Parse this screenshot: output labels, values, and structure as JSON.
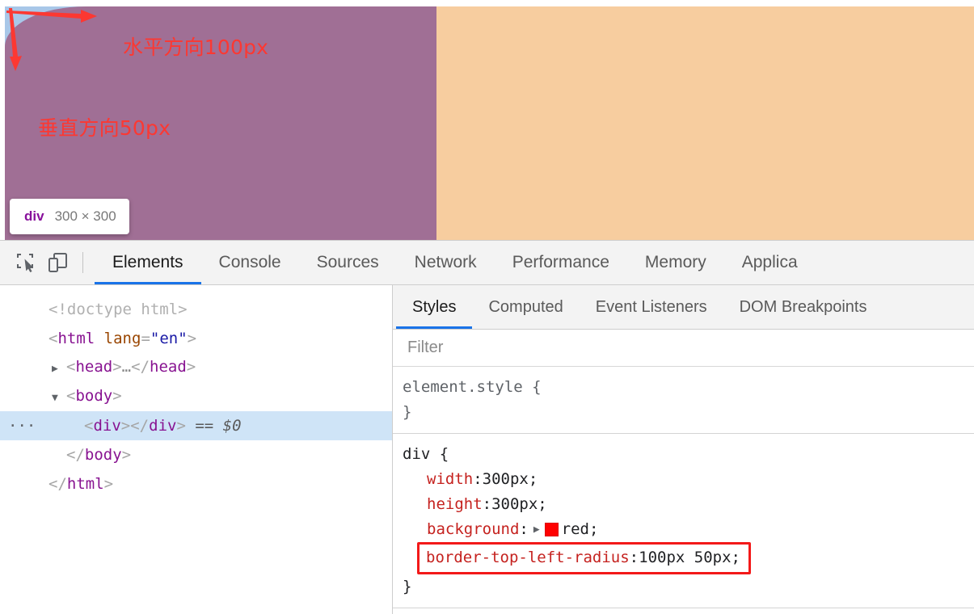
{
  "viewport": {
    "annotations": [
      {
        "id": "horizontal",
        "text": "水平方向100px"
      },
      {
        "id": "vertical",
        "text": "垂直方向50px"
      }
    ],
    "element_tooltip": {
      "tag": "div",
      "dimensions": "300 × 300"
    },
    "overlay_colors": {
      "content_box": "#a8c7e8",
      "margin_box": "#f7cd9f",
      "painted_element": "#a06f95",
      "annotation_red": "#fc3832"
    }
  },
  "devtools": {
    "toolbar": {
      "inspect_icon": "inspect-element-icon",
      "device_icon": "device-toolbar-icon"
    },
    "panel_tabs": [
      {
        "label": "Elements",
        "active": true
      },
      {
        "label": "Console",
        "active": false
      },
      {
        "label": "Sources",
        "active": false
      },
      {
        "label": "Network",
        "active": false
      },
      {
        "label": "Performance",
        "active": false
      },
      {
        "label": "Memory",
        "active": false
      },
      {
        "label": "Applica",
        "active": false
      }
    ],
    "dom_tree": [
      {
        "gutter": "",
        "indent": 0,
        "twisty": "",
        "selected": false,
        "parts": [
          {
            "t": "doctype",
            "v": "<!doctype html>"
          }
        ]
      },
      {
        "gutter": "",
        "indent": 0,
        "twisty": "",
        "selected": false,
        "parts": [
          {
            "t": "bracket",
            "v": "<"
          },
          {
            "t": "tag",
            "v": "html"
          },
          {
            "t": "space",
            "v": " "
          },
          {
            "t": "attr",
            "v": "lang"
          },
          {
            "t": "bracket",
            "v": "="
          },
          {
            "t": "val",
            "v": "\"en\""
          },
          {
            "t": "bracket",
            "v": ">"
          }
        ]
      },
      {
        "gutter": "",
        "indent": 1,
        "twisty": "▶",
        "selected": false,
        "parts": [
          {
            "t": "bracket",
            "v": "<"
          },
          {
            "t": "tag",
            "v": "head"
          },
          {
            "t": "bracket",
            "v": ">"
          },
          {
            "t": "ellip",
            "v": "…"
          },
          {
            "t": "bracket",
            "v": "</"
          },
          {
            "t": "tag",
            "v": "head"
          },
          {
            "t": "bracket",
            "v": ">"
          }
        ]
      },
      {
        "gutter": "",
        "indent": 1,
        "twisty": "▼",
        "selected": false,
        "parts": [
          {
            "t": "bracket",
            "v": "<"
          },
          {
            "t": "tag",
            "v": "body"
          },
          {
            "t": "bracket",
            "v": ">"
          }
        ]
      },
      {
        "gutter": "···",
        "indent": 2,
        "twisty": "",
        "selected": true,
        "parts": [
          {
            "t": "bracket",
            "v": "<"
          },
          {
            "t": "tag",
            "v": "div"
          },
          {
            "t": "bracket",
            "v": ">"
          },
          {
            "t": "bracket",
            "v": "</"
          },
          {
            "t": "tag",
            "v": "div"
          },
          {
            "t": "bracket",
            "v": ">"
          },
          {
            "t": "space",
            "v": " "
          },
          {
            "t": "eq",
            "v": "== $0"
          }
        ]
      },
      {
        "gutter": "",
        "indent": 1,
        "twisty": "",
        "selected": false,
        "parts": [
          {
            "t": "bracket",
            "v": "</"
          },
          {
            "t": "tag",
            "v": "body"
          },
          {
            "t": "bracket",
            "v": ">"
          }
        ]
      },
      {
        "gutter": "",
        "indent": 0,
        "twisty": "",
        "selected": false,
        "parts": [
          {
            "t": "bracket",
            "v": "</"
          },
          {
            "t": "tag",
            "v": "html"
          },
          {
            "t": "bracket",
            "v": ">"
          }
        ]
      }
    ],
    "styles_tabs": [
      {
        "label": "Styles",
        "active": true
      },
      {
        "label": "Computed",
        "active": false
      },
      {
        "label": "Event Listeners",
        "active": false
      },
      {
        "label": "DOM Breakpoints",
        "active": false
      }
    ],
    "filter": {
      "placeholder": "Filter",
      "value": ""
    },
    "rules": [
      {
        "selector": "element.style",
        "selector_style": "gray",
        "open_brace": "{",
        "close_brace": "}",
        "declarations": []
      },
      {
        "selector": "div",
        "selector_style": "dark",
        "open_brace": "{",
        "close_brace": "}",
        "declarations": [
          {
            "property": "width",
            "separator": ": ",
            "value": "300px;",
            "has_swatch": false,
            "highlighted": false
          },
          {
            "property": "height",
            "separator": ": ",
            "value": "300px;",
            "has_swatch": false,
            "highlighted": false
          },
          {
            "property": "background",
            "separator": ": ",
            "value": "red;",
            "has_swatch": true,
            "swatch_color": "#ff0000",
            "expand_arrow": "▶",
            "highlighted": false
          },
          {
            "property": "border-top-left-radius",
            "separator": ": ",
            "value": "100px 50px;",
            "has_swatch": false,
            "highlighted": true,
            "highlight_color": "#f31919"
          }
        ]
      }
    ]
  }
}
